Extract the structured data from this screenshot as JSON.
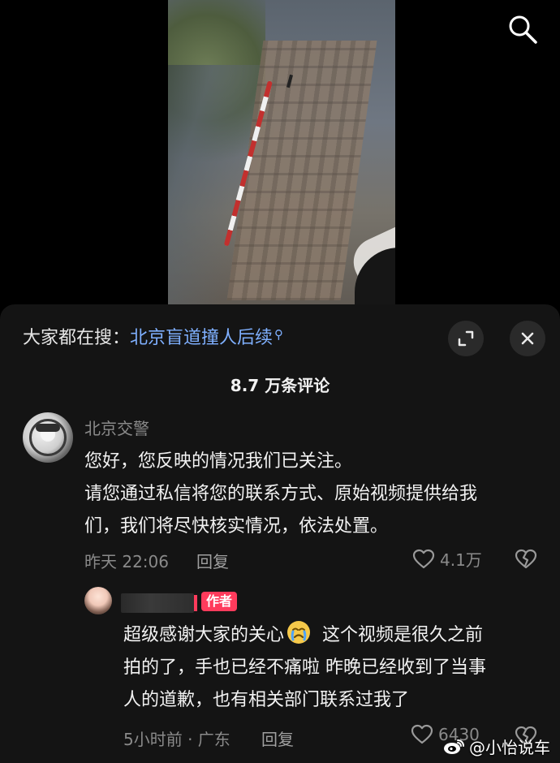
{
  "search_tip": {
    "prefix": "大家都在搜：",
    "query": "北京盲道撞人后续"
  },
  "comment_count": "8.7 万条评论",
  "comments": [
    {
      "username": "北京交警",
      "text_lines": [
        "您好，您反映的情况我们已关注。",
        "请您通过私信将您的联系方式、原始视频提供给我",
        "们，我们将尽快核实情况，依法处置。"
      ],
      "time": "昨天 22:06",
      "reply": "回复",
      "likes": "4.1万"
    }
  ],
  "reply_comment": {
    "badge": "作者",
    "text_parts": {
      "before_emoji": "超级感谢大家的关心",
      "after_emoji": " 这个视频是很久之前",
      "line2": "拍的了，手也已经不痛啦 昨晚已经收到了当事",
      "line3": "人的道歉，也有相关部门联系过我了"
    },
    "time_location": "5小时前 · 广东",
    "reply": "回复",
    "likes": "6430"
  },
  "watermark": "@小怡说车",
  "icons": {
    "search": "search-icon",
    "expand": "expand-icon",
    "close": "close-icon",
    "heart": "heart-outline-icon",
    "dislike": "broken-heart-icon",
    "emoji": "crying-face-emoji"
  },
  "colors": {
    "accent_link": "#7fb0ff",
    "author_badge": "#ff3b5c",
    "panel_bg": "#141414"
  }
}
